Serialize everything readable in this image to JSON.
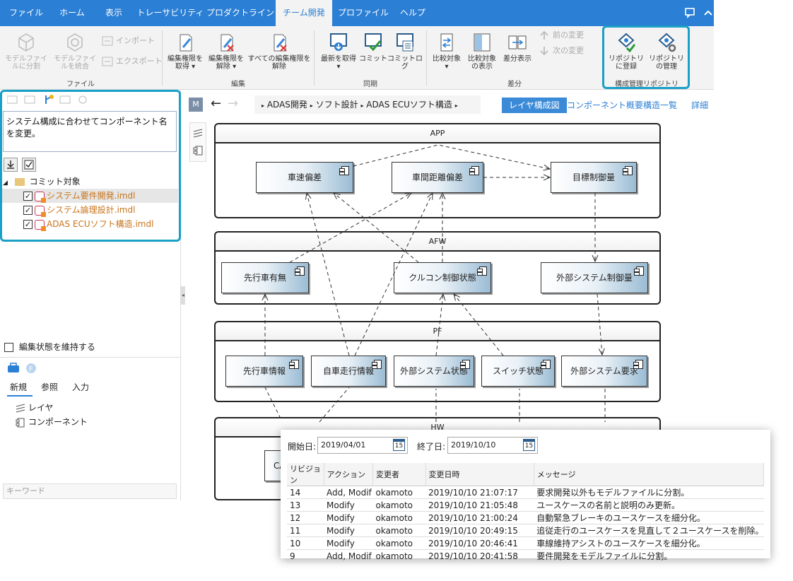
{
  "tabs": [
    "ファイル",
    "ホーム",
    "表示",
    "トレーサビリティ",
    "プロダクトライン",
    "チーム開発",
    "プロファイル",
    "ヘルプ"
  ],
  "ribbon": {
    "split_model": "モデルファイルに分割",
    "merge_model": "モデルファイルを統合",
    "import": "インポート",
    "export": "エクスポート",
    "group_file": "ファイル",
    "get_edit": "編集権限を取得",
    "release_edit": "編集権限を解除",
    "release_all": "すべての編集権限を解除",
    "group_edit": "編集",
    "get_latest": "最新を取得",
    "commit": "コミット",
    "commit_log": "コミットログ",
    "group_sync": "同期",
    "compare": "比較対象",
    "show_compare": "比較対象の表示",
    "show_diff": "差分表示",
    "prev_change": "前の変更",
    "next_change": "次の変更",
    "group_diff": "差分",
    "register_repo": "リポジトリに登録",
    "manage_repo": "リポジトリの管理",
    "group_repo": "構成管理リポジトリ"
  },
  "left": {
    "commit_message": "システム構成に合わせてコンポーネント名を変更。",
    "commit_target": "コミット対象",
    "files": [
      "システム要件開発.imdl",
      "システム論理設計.imdl",
      "ADAS ECUソフト構造.imdl"
    ],
    "keep_edit": "編集状態を維持する",
    "panel_tabs": [
      "新規",
      "参照",
      "入力"
    ],
    "items": [
      "レイヤ",
      "コンポーネント"
    ],
    "keyword_placeholder": "キーワード"
  },
  "main": {
    "m_badge": "M",
    "breadcrumb": [
      "ADAS開発",
      "ソフト設計",
      "ADAS ECUソフト構造"
    ],
    "view_tabs": [
      "レイヤ構成図",
      "コンポーネント概要",
      "構造一覧",
      "詳細"
    ],
    "layers": [
      "APP",
      "AFW",
      "PF",
      "HW"
    ],
    "components": {
      "app": [
        "車速偏差",
        "車間距離偏差",
        "目標制御量"
      ],
      "afw": [
        "先行車有無",
        "クルコン制御状態",
        "外部システム制御量"
      ],
      "pf": [
        "先行車情報",
        "自車走行情報",
        "外部システム状態",
        "スイッチ状態",
        "外部システム要求"
      ],
      "hw": [
        "CA"
      ]
    }
  },
  "history": {
    "start_label": "開始日:",
    "start_date": "2019/04/01",
    "end_label": "終了日:",
    "end_date": "2019/10/10",
    "cal_num": "15",
    "columns": [
      "リビジョン",
      "アクション",
      "変更者",
      "変更日時",
      "メッセージ"
    ],
    "rows": [
      [
        "14",
        "Add, Modif",
        "okamoto",
        "2019/10/10 21:07:17",
        "要求開発以外もモデルファイルに分割。"
      ],
      [
        "13",
        "Modify",
        "okamoto",
        "2019/10/10 21:05:48",
        "ユースケースの名前と説明のみ更新。"
      ],
      [
        "12",
        "Modify",
        "okamoto",
        "2019/10/10 21:00:24",
        "自動緊急ブレーキのユースケースを細分化。"
      ],
      [
        "11",
        "Modify",
        "okamoto",
        "2019/10/10 20:49:15",
        "追従走行のユースケースを見直して２ユースケースを削除。"
      ],
      [
        "10",
        "Modify",
        "okamoto",
        "2019/10/10 20:46:41",
        "車線維持アシストのユースケースを細分化。"
      ],
      [
        "9",
        "Add, Modif",
        "okamoto",
        "2019/10/10 20:41:58",
        "要件開発をモデルファイルに分割。"
      ]
    ]
  }
}
